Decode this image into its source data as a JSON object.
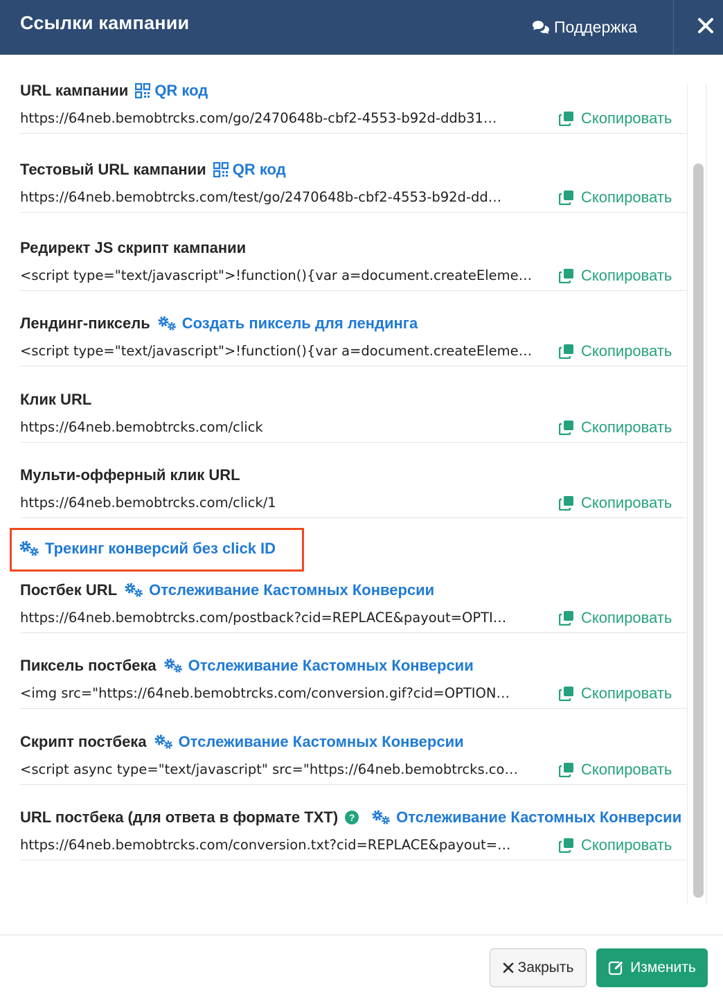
{
  "header": {
    "title": "Ссылки кампании",
    "support_label": "Поддержка"
  },
  "items": [
    {
      "label": "URL кампании",
      "link": "QR код",
      "link_icon": "qr-icon",
      "value": "https://64neb.bemobtrcks.com/go/2470648b-cbf2-4553-b92d-ddb31…",
      "copy": "Скопировать"
    },
    {
      "label": "Тестовый URL кампании",
      "link": "QR код",
      "link_icon": "qr-icon",
      "value": "https://64neb.bemobtrcks.com/test/go/2470648b-cbf2-4553-b92d-dd…",
      "copy": "Скопировать"
    },
    {
      "label": "Редирект JS скрипт кампании",
      "value": "<script type=\"text/javascript\">!function(){var a=document.createEleme…",
      "copy": "Скопировать"
    },
    {
      "label": "Лендинг-пиксель",
      "link": "Создать пиксель для лендинга",
      "link_icon": "gears-icon",
      "value": "<script type=\"text/javascript\">!function(){var a=document.createEleme…",
      "copy": "Скопировать"
    },
    {
      "label": "Клик URL",
      "value": "https://64neb.bemobtrcks.com/click",
      "copy": "Скопировать"
    },
    {
      "label": "Мульти-офферный клик URL",
      "value": "https://64neb.bemobtrcks.com/click/1",
      "copy": "Скопировать"
    },
    {
      "label": "Постбек URL",
      "link": "Отслеживание Кастомных Конверсии",
      "link_icon": "gears-icon",
      "value": "https://64neb.bemobtrcks.com/postback?cid=REPLACE&payout=OPTI…",
      "copy": "Скопировать"
    },
    {
      "label": "Пиксель постбека",
      "link": "Отслеживание Кастомных Конверсии",
      "link_icon": "gears-icon",
      "value": "<img src=\"https://64neb.bemobtrcks.com/conversion.gif?cid=OPTION…",
      "copy": "Скопировать"
    },
    {
      "label": "Скрипт постбека",
      "link": "Отслеживание Кастомных Конверсии",
      "link_icon": "gears-icon",
      "value": "<script async type=\"text/javascript\" src=\"https://64neb.bemobtrcks.co…",
      "copy": "Скопировать"
    },
    {
      "label": "URL постбека (для ответа в формате TXT)",
      "link": "Отслеживание Кастомных Конверсии",
      "link_icon": "gears-icon",
      "value": "https://64neb.bemobtrcks.com/conversion.txt?cid=REPLACE&payout=…",
      "copy": "Скопировать"
    }
  ],
  "tracking_link": "Трекинг конверсий без click ID",
  "help_glyph": "?",
  "footer": {
    "close_label": "Закрыть",
    "edit_label": "Изменить"
  },
  "colors": {
    "header_bg": "#2e4b73",
    "link": "#1f7ad6",
    "copy": "#25a27d",
    "primary_button": "#1f9e76",
    "highlight_border": "#ef4a1d"
  }
}
